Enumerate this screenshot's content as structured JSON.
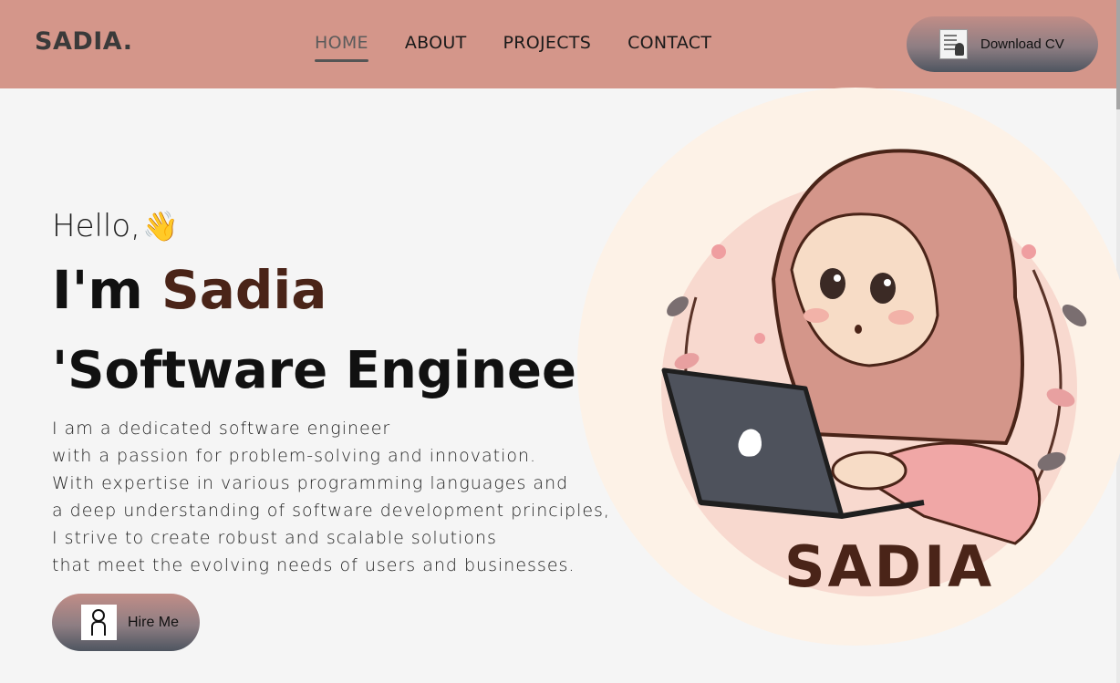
{
  "header": {
    "logo": "SADIA.",
    "nav": [
      {
        "label": "HOME",
        "active": true
      },
      {
        "label": "ABOUT",
        "active": false
      },
      {
        "label": "PROJECTS",
        "active": false
      },
      {
        "label": "CONTACT",
        "active": false
      }
    ],
    "cv_button": {
      "label": "Download CV",
      "icon": "document-icon"
    }
  },
  "hero": {
    "greeting": "Hello,",
    "greeting_emoji": "👋",
    "intro_prefix": "I'm",
    "intro_name": "Sadia",
    "role": "'Software Engineer'",
    "role_icon": "laptop-icon",
    "bio_lines": [
      "I am a dedicated software engineer",
      "with a passion for problem-solving and innovation.",
      "With expertise in various programming languages and",
      "a deep understanding of software development principles,",
      "I strive to create robust and scalable solutions",
      "that meet the evolving needs of users and businesses."
    ],
    "hire_button": {
      "label": "Hire Me",
      "icon": "person-check-icon"
    }
  },
  "illustration": {
    "label": "SADIA"
  },
  "colors": {
    "header_bg": "#d4968a",
    "name_accent": "#4a2418",
    "page_bg": "#f5f5f5",
    "illustration_bg": "#fdf2e7"
  }
}
